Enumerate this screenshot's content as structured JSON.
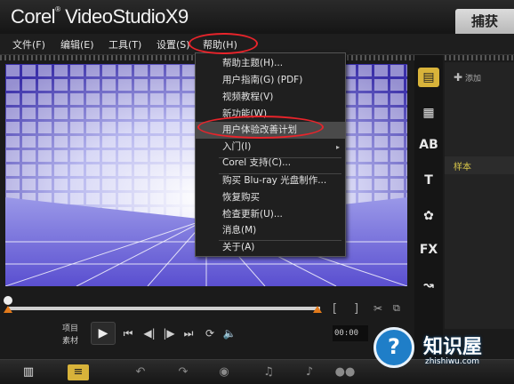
{
  "app": {
    "title_prefix": "Corel",
    "title_reg": "®",
    "title_main": " VideoStudioX9",
    "capture_tab": "捕获"
  },
  "menubar": {
    "file": "文件(F)",
    "edit": "编辑(E)",
    "tools": "工具(T)",
    "settings": "设置(S)",
    "help": "帮助(H)"
  },
  "help_menu": {
    "items": [
      "帮助主题(H)...",
      "用户指南(G) (PDF)",
      "视频教程(V)",
      "新功能(W)",
      "用户体验改善计划",
      "入门(I)",
      "Corel 支持(C)...",
      "购买 Blu-ray 光盘制作...",
      "恢复购买",
      "检查更新(U)...",
      "消息(M)",
      "关于(A)"
    ],
    "submenu_arrow": "▸"
  },
  "library": {
    "add_label": "添加",
    "add_icon": "plus-icon",
    "sample_label": "样本"
  },
  "player": {
    "mode_project": "项目",
    "mode_clip": "素材",
    "timecode": "00:00",
    "bracket_in": "[",
    "bracket_out": "]"
  },
  "watermark": {
    "badge": "?",
    "title": "知识屋",
    "url": "zhishiwu.com"
  },
  "colors": {
    "highlight_oval": "#e8242b",
    "scrub_marker": "#e27a1b",
    "sample_text": "#d9c74a"
  }
}
